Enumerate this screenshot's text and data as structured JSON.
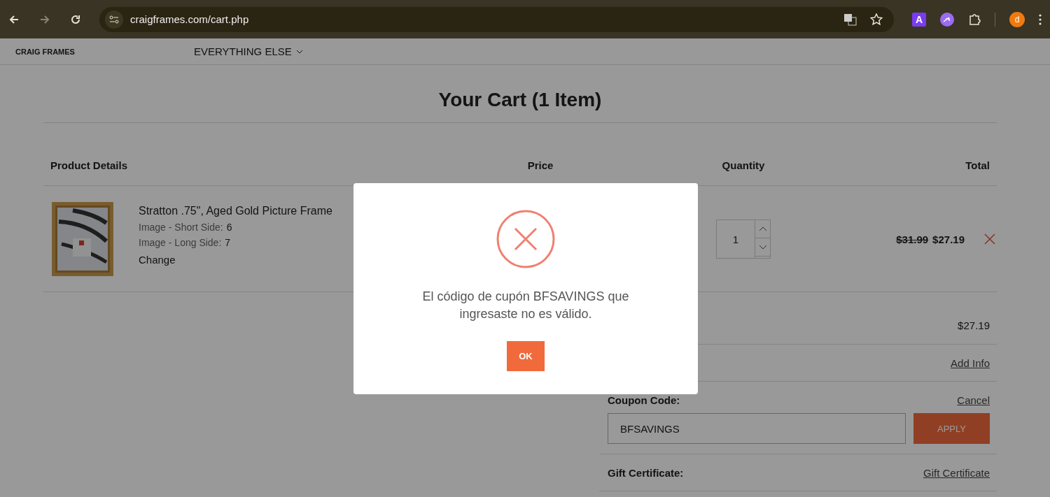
{
  "browser": {
    "url": "craigframes.com/cart.php",
    "avatar": "d",
    "extension_letter": "A"
  },
  "site_nav": {
    "logo": "CRAIG FRAMES",
    "menu_item": "EVERYTHING ELSE"
  },
  "cart": {
    "title": "Your Cart (1 Item)",
    "columns": [
      "Product Details",
      "Price",
      "Quantity",
      "Total"
    ],
    "items": [
      {
        "name": "Stratton .75\", Aged Gold Picture Frame",
        "options": [
          {
            "label": "Image - Short Side:",
            "value": "6"
          },
          {
            "label": "Image - Long Side:",
            "value": "7"
          }
        ],
        "change": "Change",
        "quantity": "1",
        "old_total": "$31.99",
        "total": "$27.19"
      }
    ]
  },
  "summary": {
    "subtotal": "$27.19",
    "shipping_link": "Add Info",
    "coupon_label": "Coupon Code:",
    "coupon_cancel": "Cancel",
    "coupon_value": "BFSAVINGS",
    "apply": "APPLY",
    "gift_label": "Gift Certificate:",
    "gift_link": "Gift Certificate"
  },
  "dialog": {
    "message": "El código de cupón BFSAVINGS que ingresaste no es válido.",
    "ok": "OK"
  }
}
